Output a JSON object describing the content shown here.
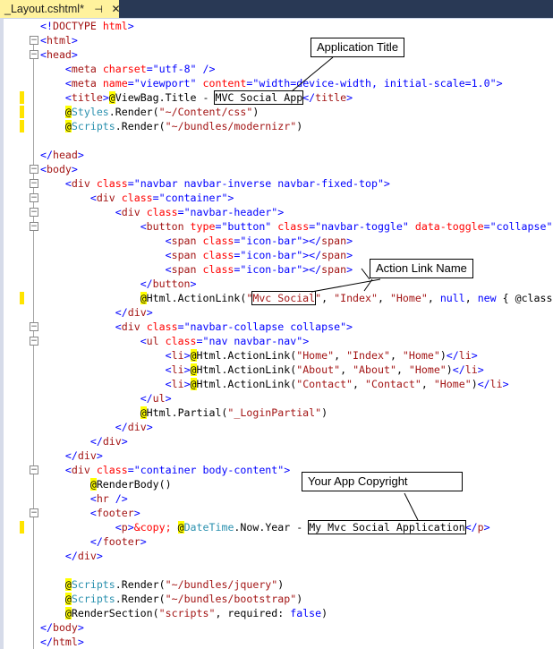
{
  "tab": {
    "title": "_Layout.cshtml*",
    "pin_icon": "⊣",
    "close_icon": "✕"
  },
  "annotations": {
    "app_title": "Application Title",
    "action_link": "Action Link Name",
    "copyright": "Your App Copyright"
  },
  "code_lines": [
    [
      [
        "d",
        "<!"
      ],
      [
        "t",
        "DOCTYPE"
      ],
      [
        "x",
        " "
      ],
      [
        "a",
        "html"
      ],
      [
        "d",
        ">"
      ]
    ],
    [
      [
        "d",
        "<"
      ],
      [
        "t",
        "html"
      ],
      [
        "d",
        ">"
      ]
    ],
    [
      [
        "d",
        "<"
      ],
      [
        "t",
        "head"
      ],
      [
        "d",
        ">"
      ]
    ],
    [
      [
        "x",
        "    "
      ],
      [
        "d",
        "<"
      ],
      [
        "t",
        "meta"
      ],
      [
        "x",
        " "
      ],
      [
        "a",
        "charset"
      ],
      [
        "d",
        "=\"utf-8\" />"
      ]
    ],
    [
      [
        "x",
        "    "
      ],
      [
        "d",
        "<"
      ],
      [
        "t",
        "meta"
      ],
      [
        "x",
        " "
      ],
      [
        "a",
        "name"
      ],
      [
        "d",
        "=\"viewport\""
      ],
      [
        "x",
        " "
      ],
      [
        "a",
        "content"
      ],
      [
        "d",
        "=\"width=device-width, initial-scale=1.0\">"
      ]
    ],
    [
      [
        "x",
        "    "
      ],
      [
        "d",
        "<"
      ],
      [
        "t",
        "title"
      ],
      [
        "d",
        ">"
      ],
      [
        "r",
        "@"
      ],
      [
        "x",
        "ViewBag.Title - "
      ],
      [
        "x",
        "MVC Social App",
        "box"
      ],
      [
        "d",
        "</"
      ],
      [
        "t",
        "title"
      ],
      [
        "d",
        ">"
      ]
    ],
    [
      [
        "x",
        "    "
      ],
      [
        "r",
        "@"
      ],
      [
        "c",
        "Styles"
      ],
      [
        "x",
        ".Render("
      ],
      [
        "t",
        "\"~/Content/css\""
      ],
      [
        "x",
        ")"
      ]
    ],
    [
      [
        "x",
        "    "
      ],
      [
        "r",
        "@"
      ],
      [
        "c",
        "Scripts"
      ],
      [
        "x",
        ".Render("
      ],
      [
        "t",
        "\"~/bundles/modernizr\""
      ],
      [
        "x",
        ")"
      ]
    ],
    [],
    [
      [
        "d",
        "</"
      ],
      [
        "t",
        "head"
      ],
      [
        "d",
        ">"
      ]
    ],
    [
      [
        "d",
        "<"
      ],
      [
        "t",
        "body"
      ],
      [
        "d",
        ">"
      ]
    ],
    [
      [
        "x",
        "    "
      ],
      [
        "d",
        "<"
      ],
      [
        "t",
        "div"
      ],
      [
        "x",
        " "
      ],
      [
        "a",
        "class"
      ],
      [
        "d",
        "=\"navbar navbar-inverse navbar-fixed-top\">"
      ]
    ],
    [
      [
        "x",
        "        "
      ],
      [
        "d",
        "<"
      ],
      [
        "t",
        "div"
      ],
      [
        "x",
        " "
      ],
      [
        "a",
        "class"
      ],
      [
        "d",
        "=\"container\">"
      ]
    ],
    [
      [
        "x",
        "            "
      ],
      [
        "d",
        "<"
      ],
      [
        "t",
        "div"
      ],
      [
        "x",
        " "
      ],
      [
        "a",
        "class"
      ],
      [
        "d",
        "=\"navbar-header\">"
      ]
    ],
    [
      [
        "x",
        "                "
      ],
      [
        "d",
        "<"
      ],
      [
        "t",
        "button"
      ],
      [
        "x",
        " "
      ],
      [
        "a",
        "type"
      ],
      [
        "d",
        "=\"button\""
      ],
      [
        "x",
        " "
      ],
      [
        "a",
        "class"
      ],
      [
        "d",
        "=\"navbar-toggle\""
      ],
      [
        "x",
        " "
      ],
      [
        "a",
        "data-toggle"
      ],
      [
        "d",
        "=\"collapse\""
      ]
    ],
    [
      [
        "x",
        "                    "
      ],
      [
        "d",
        "<"
      ],
      [
        "t",
        "span"
      ],
      [
        "x",
        " "
      ],
      [
        "a",
        "class"
      ],
      [
        "d",
        "=\"icon-bar\"></"
      ],
      [
        "t",
        "span"
      ],
      [
        "d",
        ">"
      ]
    ],
    [
      [
        "x",
        "                    "
      ],
      [
        "d",
        "<"
      ],
      [
        "t",
        "span"
      ],
      [
        "x",
        " "
      ],
      [
        "a",
        "class"
      ],
      [
        "d",
        "=\"icon-bar\"></"
      ],
      [
        "t",
        "span"
      ],
      [
        "d",
        ">"
      ]
    ],
    [
      [
        "x",
        "                    "
      ],
      [
        "d",
        "<"
      ],
      [
        "t",
        "span"
      ],
      [
        "x",
        " "
      ],
      [
        "a",
        "class"
      ],
      [
        "d",
        "=\"icon-bar\"></"
      ],
      [
        "t",
        "span"
      ],
      [
        "d",
        ">"
      ]
    ],
    [
      [
        "x",
        "                "
      ],
      [
        "d",
        "</"
      ],
      [
        "t",
        "button"
      ],
      [
        "d",
        ">"
      ]
    ],
    [
      [
        "x",
        "                "
      ],
      [
        "r",
        "@"
      ],
      [
        "x",
        "Html.ActionLink("
      ],
      [
        "t",
        "\""
      ],
      [
        "t",
        "Mvc Social",
        "box"
      ],
      [
        "t",
        "\""
      ],
      [
        "x",
        ", "
      ],
      [
        "t",
        "\"Index\""
      ],
      [
        "x",
        ", "
      ],
      [
        "t",
        "\"Home\""
      ],
      [
        "x",
        ", "
      ],
      [
        "k",
        "null"
      ],
      [
        "x",
        ", "
      ],
      [
        "k",
        "new"
      ],
      [
        "x",
        " { @class"
      ]
    ],
    [
      [
        "x",
        "            "
      ],
      [
        "d",
        "</"
      ],
      [
        "t",
        "div"
      ],
      [
        "d",
        ">"
      ]
    ],
    [
      [
        "x",
        "            "
      ],
      [
        "d",
        "<"
      ],
      [
        "t",
        "div"
      ],
      [
        "x",
        " "
      ],
      [
        "a",
        "class"
      ],
      [
        "d",
        "=\"navbar-collapse collapse\">"
      ]
    ],
    [
      [
        "x",
        "                "
      ],
      [
        "d",
        "<"
      ],
      [
        "t",
        "ul"
      ],
      [
        "x",
        " "
      ],
      [
        "a",
        "class"
      ],
      [
        "d",
        "=\"nav navbar-nav\">"
      ]
    ],
    [
      [
        "x",
        "                    "
      ],
      [
        "d",
        "<"
      ],
      [
        "t",
        "li"
      ],
      [
        "d",
        ">"
      ],
      [
        "r",
        "@"
      ],
      [
        "x",
        "Html.ActionLink("
      ],
      [
        "t",
        "\"Home\""
      ],
      [
        "x",
        ", "
      ],
      [
        "t",
        "\"Index\""
      ],
      [
        "x",
        ", "
      ],
      [
        "t",
        "\"Home\""
      ],
      [
        "x",
        ")"
      ],
      [
        "d",
        "</"
      ],
      [
        "t",
        "li"
      ],
      [
        "d",
        ">"
      ]
    ],
    [
      [
        "x",
        "                    "
      ],
      [
        "d",
        "<"
      ],
      [
        "t",
        "li"
      ],
      [
        "d",
        ">"
      ],
      [
        "r",
        "@"
      ],
      [
        "x",
        "Html.ActionLink("
      ],
      [
        "t",
        "\"About\""
      ],
      [
        "x",
        ", "
      ],
      [
        "t",
        "\"About\""
      ],
      [
        "x",
        ", "
      ],
      [
        "t",
        "\"Home\""
      ],
      [
        "x",
        ")"
      ],
      [
        "d",
        "</"
      ],
      [
        "t",
        "li"
      ],
      [
        "d",
        ">"
      ]
    ],
    [
      [
        "x",
        "                    "
      ],
      [
        "d",
        "<"
      ],
      [
        "t",
        "li"
      ],
      [
        "d",
        ">"
      ],
      [
        "r",
        "@"
      ],
      [
        "x",
        "Html.ActionLink("
      ],
      [
        "t",
        "\"Contact\""
      ],
      [
        "x",
        ", "
      ],
      [
        "t",
        "\"Contact\""
      ],
      [
        "x",
        ", "
      ],
      [
        "t",
        "\"Home\""
      ],
      [
        "x",
        ")"
      ],
      [
        "d",
        "</"
      ],
      [
        "t",
        "li"
      ],
      [
        "d",
        ">"
      ]
    ],
    [
      [
        "x",
        "                "
      ],
      [
        "d",
        "</"
      ],
      [
        "t",
        "ul"
      ],
      [
        "d",
        ">"
      ]
    ],
    [
      [
        "x",
        "                "
      ],
      [
        "r",
        "@"
      ],
      [
        "x",
        "Html.Partial("
      ],
      [
        "t",
        "\"_LoginPartial\""
      ],
      [
        "x",
        ")"
      ]
    ],
    [
      [
        "x",
        "            "
      ],
      [
        "d",
        "</"
      ],
      [
        "t",
        "div"
      ],
      [
        "d",
        ">"
      ]
    ],
    [
      [
        "x",
        "        "
      ],
      [
        "d",
        "</"
      ],
      [
        "t",
        "div"
      ],
      [
        "d",
        ">"
      ]
    ],
    [
      [
        "x",
        "    "
      ],
      [
        "d",
        "</"
      ],
      [
        "t",
        "div"
      ],
      [
        "d",
        ">"
      ]
    ],
    [
      [
        "x",
        "    "
      ],
      [
        "d",
        "<"
      ],
      [
        "t",
        "div"
      ],
      [
        "x",
        " "
      ],
      [
        "a",
        "class"
      ],
      [
        "d",
        "=\"container body-content\">"
      ]
    ],
    [
      [
        "x",
        "        "
      ],
      [
        "r",
        "@"
      ],
      [
        "x",
        "RenderBody()"
      ]
    ],
    [
      [
        "x",
        "        "
      ],
      [
        "d",
        "<"
      ],
      [
        "t",
        "hr"
      ],
      [
        "x",
        " "
      ],
      [
        "d",
        "/>"
      ]
    ],
    [
      [
        "x",
        "        "
      ],
      [
        "d",
        "<"
      ],
      [
        "t",
        "footer"
      ],
      [
        "d",
        ">"
      ]
    ],
    [
      [
        "x",
        "            "
      ],
      [
        "d",
        "<"
      ],
      [
        "t",
        "p"
      ],
      [
        "d",
        ">"
      ],
      [
        "a",
        "&copy;"
      ],
      [
        "x",
        " "
      ],
      [
        "r",
        "@"
      ],
      [
        "c",
        "DateTime"
      ],
      [
        "x",
        ".Now.Year - "
      ],
      [
        "x",
        "My Mvc Social Application",
        "box"
      ],
      [
        "d",
        "</"
      ],
      [
        "t",
        "p"
      ],
      [
        "d",
        ">"
      ]
    ],
    [
      [
        "x",
        "        "
      ],
      [
        "d",
        "</"
      ],
      [
        "t",
        "footer"
      ],
      [
        "d",
        ">"
      ]
    ],
    [
      [
        "x",
        "    "
      ],
      [
        "d",
        "</"
      ],
      [
        "t",
        "div"
      ],
      [
        "d",
        ">"
      ]
    ],
    [],
    [
      [
        "x",
        "    "
      ],
      [
        "r",
        "@"
      ],
      [
        "c",
        "Scripts"
      ],
      [
        "x",
        ".Render("
      ],
      [
        "t",
        "\"~/bundles/jquery\""
      ],
      [
        "x",
        ")"
      ]
    ],
    [
      [
        "x",
        "    "
      ],
      [
        "r",
        "@"
      ],
      [
        "c",
        "Scripts"
      ],
      [
        "x",
        ".Render("
      ],
      [
        "t",
        "\"~/bundles/bootstrap\""
      ],
      [
        "x",
        ")"
      ]
    ],
    [
      [
        "x",
        "    "
      ],
      [
        "r",
        "@"
      ],
      [
        "x",
        "RenderSection("
      ],
      [
        "t",
        "\"scripts\""
      ],
      [
        "x",
        ", required: "
      ],
      [
        "k",
        "false"
      ],
      [
        "x",
        ")"
      ]
    ],
    [
      [
        "d",
        "</"
      ],
      [
        "t",
        "body"
      ],
      [
        "d",
        ">"
      ]
    ],
    [
      [
        "d",
        "</"
      ],
      [
        "t",
        "html"
      ],
      [
        "d",
        ">"
      ]
    ]
  ],
  "changed_lines": [
    6,
    7,
    8,
    20,
    36
  ],
  "fold_lines": [
    2,
    3,
    11,
    12,
    13,
    14,
    15,
    22,
    23,
    32,
    35
  ]
}
